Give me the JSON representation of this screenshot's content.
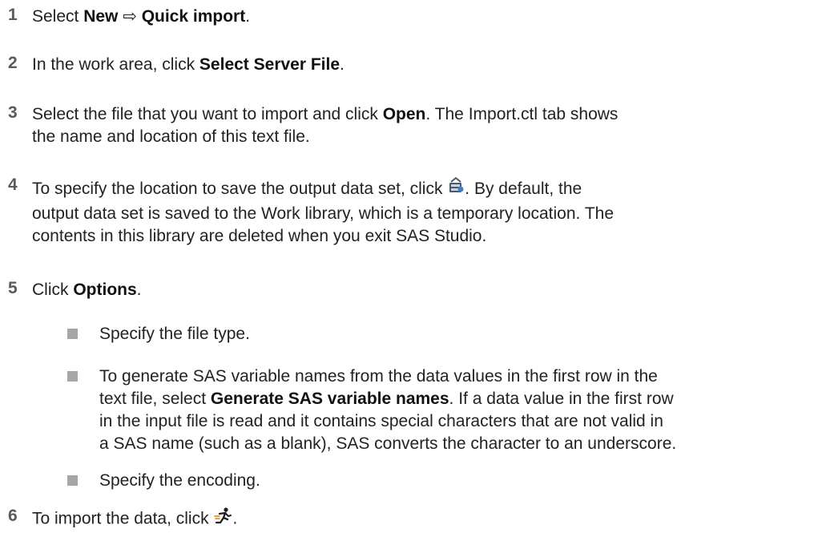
{
  "steps": [
    {
      "number": "1",
      "prefix": "Select ",
      "bold1": "New",
      "arrow": "⇨",
      "bold2": "Quick import",
      "suffix": "."
    },
    {
      "number": "2",
      "prefix": "In the work area, click ",
      "bold": "Select Server File",
      "suffix": "."
    },
    {
      "number": "3",
      "line1_prefix": "Select the file that you want to import and click ",
      "line1_bold": "Open",
      "line1_suffix": ". The Import.ctl tab shows",
      "line2": "the name and location of this text file."
    },
    {
      "number": "4",
      "line1_prefix": "To specify the location to save the output data set, click ",
      "line1_suffix": ". By default, the",
      "line2": "output data set is saved to the Work library, which is a temporary location. The",
      "line3": "contents in this library are deleted when you exit SAS Studio.",
      "icon": "save-location-icon"
    },
    {
      "number": "5",
      "prefix": "Click ",
      "bold": "Options",
      "suffix": ".",
      "bullets": [
        {
          "text": "Specify the file type."
        },
        {
          "line1": "To generate SAS variable names from the data values in the first row in the",
          "line2_prefix": "text file, select ",
          "line2_bold": "Generate SAS variable names",
          "line2_suffix": ". If a data value in the first row",
          "line3": "in the input file is read and it contains special characters that are not valid in",
          "line4": "a SAS name (such as a blank), SAS converts the character to an underscore."
        },
        {
          "text": "Specify the encoding."
        }
      ]
    },
    {
      "number": "6",
      "prefix": "To import the data, click ",
      "suffix": ".",
      "icon": "run-icon"
    }
  ]
}
